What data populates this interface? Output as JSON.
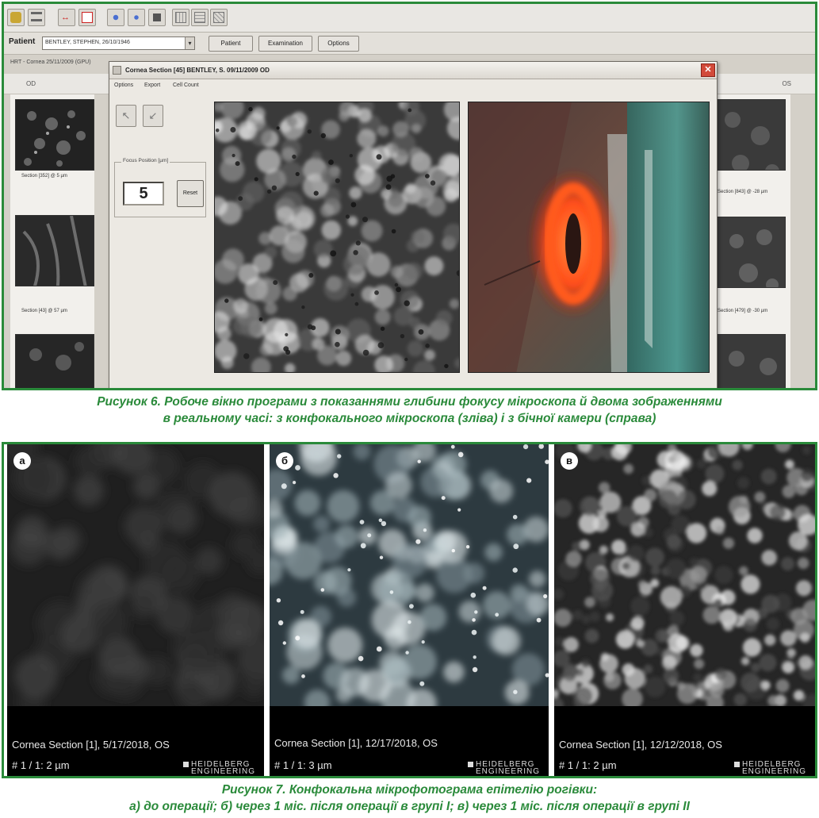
{
  "figure6": {
    "toolbar_icons": [
      "db-icon",
      "list-icon",
      "arrows-red-icon",
      "blue-molecule-icon",
      "blue-molecule-icon",
      "stop-icon",
      "grid-icon",
      "grid-icon",
      "grid-icon"
    ],
    "patient_label": "Patient",
    "patient_value": "BENTLEY, STEPHEN, 26/10/1946",
    "buttons": {
      "patient": "Patient",
      "examination": "Examination",
      "options": "Options"
    },
    "hrt_line": "HRT - Cornea 25/11/2009 (GPU)",
    "eye_left": "OD",
    "eye_right": "OS",
    "left_thumbs": [
      "Section [352] @ 5 µm",
      "Section [43] @ 57 µm",
      ""
    ],
    "right_thumbs": [
      "Section [843] @ -28 µm",
      "Section [479] @ -30 µm",
      ""
    ],
    "dialog": {
      "title": "Cornea Section [45]   BENTLEY, S.   09/11/2009   OD",
      "menu": [
        "Options",
        "Export",
        "Cell Count"
      ],
      "focus_legend": "Focus Position [µm]",
      "focus_value": "5",
      "reset_label": "Reset",
      "close_glyph": "✕"
    },
    "caption_line1": "Рисунок 6.  Робоче вікно програми з показаннями глибини фокусу мікроскопа й двома зображеннями",
    "caption_line2": "в реальному часі: з конфокального мікроскопа (зліва) і з бічної камери (справа)"
  },
  "figure7": {
    "panels": [
      {
        "label": "а",
        "line1": "Cornea Section [1],   5/17/2018,    OS",
        "line2": "# 1 / 1:     2 µm"
      },
      {
        "label": "б",
        "line1": "Cornea Section [1], 12/17/2018,    OS",
        "line2": "# 1 / 1:     3 µm"
      },
      {
        "label": "в",
        "line1": "Cornea Section [1], 12/12/2018,    OS",
        "line2": "# 1 / 1:     2 µm"
      }
    ],
    "logo_line1": "HEIDELBERG",
    "logo_line2": "ENGINEERING",
    "caption_line1": "Рисунок 7.  Конфокальна мікрофотограма епітелію рогівки:",
    "caption_line2": "а) до операції; б) через 1 міс. після операції в групі І; в) через 1 міс. після операції в групі ІІ"
  },
  "colors": {
    "accent_green": "#2a8a3a",
    "close_red": "#d24a3a",
    "laser_orange": "#ff5a1e"
  }
}
